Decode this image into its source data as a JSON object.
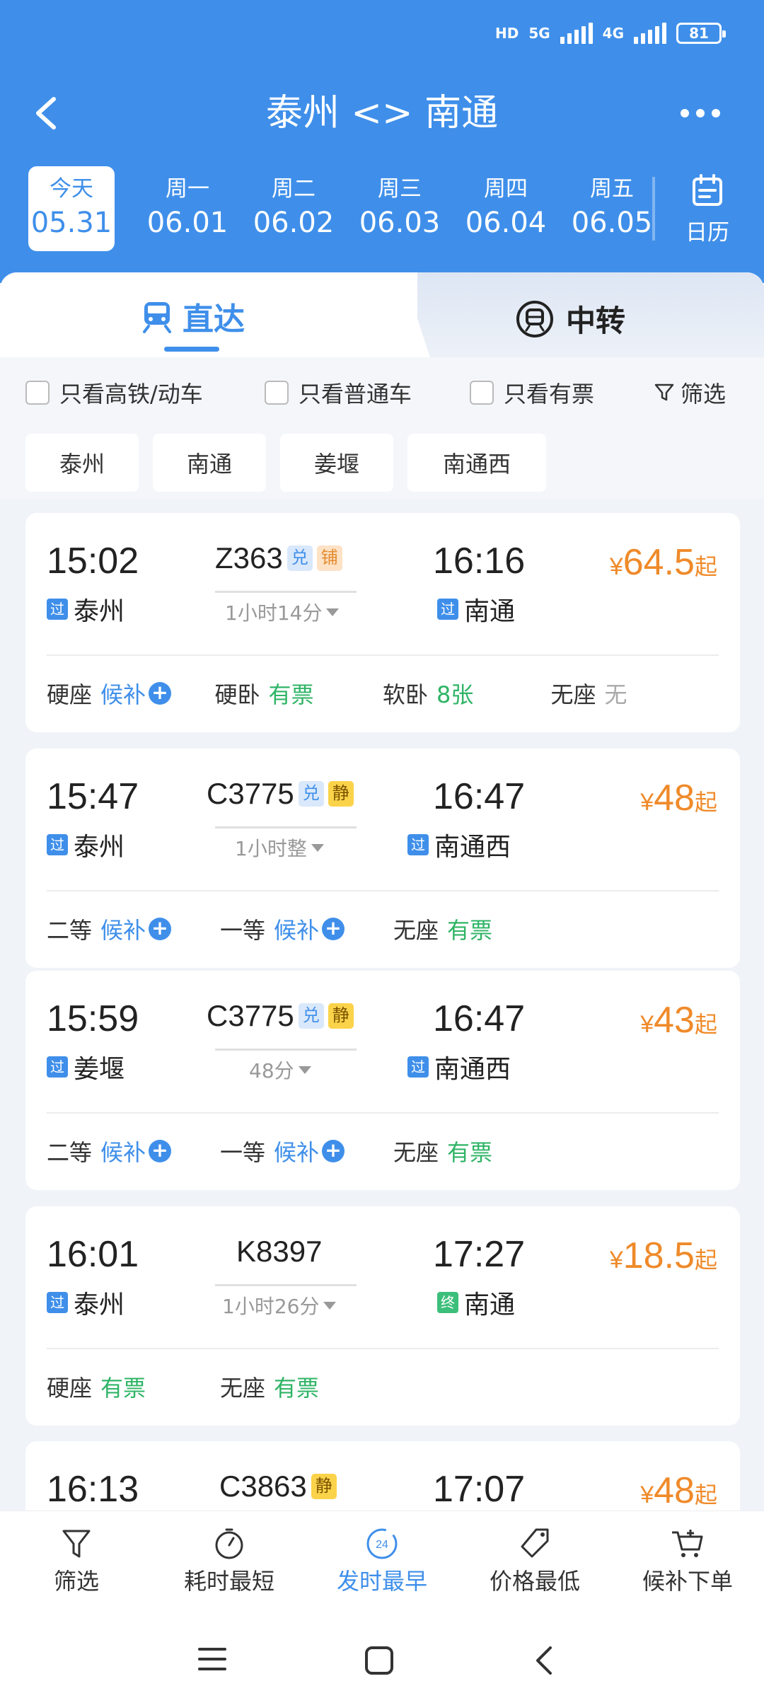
{
  "status_bar": {
    "hd": "HD",
    "net1": "5G",
    "net2": "4G",
    "battery": "81"
  },
  "header": {
    "title": "泰州 <> 南通"
  },
  "dates": [
    {
      "weekday": "今天",
      "date": "05.31",
      "active": true
    },
    {
      "weekday": "周一",
      "date": "06.01"
    },
    {
      "weekday": "周二",
      "date": "06.02"
    },
    {
      "weekday": "周三",
      "date": "06.03"
    },
    {
      "weekday": "周四",
      "date": "06.04"
    },
    {
      "weekday": "周五",
      "date": "06.05"
    }
  ],
  "calendar_label": "日历",
  "tabs": {
    "direct": "直达",
    "transfer": "中转"
  },
  "filters": {
    "hsr": "只看高铁/动车",
    "normal": "只看普通车",
    "available": "只看有票",
    "filter": "筛选"
  },
  "stations": [
    "泰州",
    "南通",
    "姜堰",
    "南通西"
  ],
  "trains": [
    {
      "dep_time": "15:02",
      "from": "泰州",
      "from_tag": "过",
      "train_no": "Z363",
      "badges": [
        "兑",
        "铺"
      ],
      "duration": "1小时14分",
      "arr_time": "16:16",
      "to": "南通",
      "to_tag": "过",
      "price_cur": "¥",
      "price": "64.5",
      "price_suffix": "起",
      "seats": [
        {
          "name": "硬座",
          "status": "候补"
        },
        {
          "name": "硬卧",
          "status": "有票"
        },
        {
          "name": "软卧",
          "status": "8张"
        },
        {
          "name": "无座",
          "status": "无"
        }
      ]
    },
    {
      "dep_time": "15:47",
      "from": "泰州",
      "from_tag": "过",
      "train_no": "C3775",
      "badges": [
        "兑",
        "静"
      ],
      "duration": "1小时整",
      "arr_time": "16:47",
      "to": "南通西",
      "to_tag": "过",
      "price_cur": "¥",
      "price": "48",
      "price_suffix": "起",
      "seats": [
        {
          "name": "二等",
          "status": "候补"
        },
        {
          "name": "一等",
          "status": "候补"
        },
        {
          "name": "无座",
          "status": "有票"
        }
      ]
    },
    {
      "dep_time": "15:59",
      "from": "姜堰",
      "from_tag": "过",
      "train_no": "C3775",
      "badges": [
        "兑",
        "静"
      ],
      "duration": "48分",
      "arr_time": "16:47",
      "to": "南通西",
      "to_tag": "过",
      "price_cur": "¥",
      "price": "43",
      "price_suffix": "起",
      "seats": [
        {
          "name": "二等",
          "status": "候补"
        },
        {
          "name": "一等",
          "status": "候补"
        },
        {
          "name": "无座",
          "status": "有票"
        }
      ]
    },
    {
      "dep_time": "16:01",
      "from": "泰州",
      "from_tag": "过",
      "train_no": "K8397",
      "badges": [],
      "duration": "1小时26分",
      "arr_time": "17:27",
      "to": "南通",
      "to_tag": "终",
      "price_cur": "¥",
      "price": "18.5",
      "price_suffix": "起",
      "seats": [
        {
          "name": "硬座",
          "status": "有票"
        },
        {
          "name": "无座",
          "status": "有票"
        }
      ]
    },
    {
      "dep_time": "16:13",
      "train_no": "C3863",
      "badges": [
        "静"
      ],
      "arr_time": "17:07",
      "price_cur": "¥",
      "price": "48",
      "price_suffix": "起"
    }
  ],
  "bottom_bar": [
    {
      "label": "筛选",
      "icon": "filter-icon"
    },
    {
      "label": "耗时最短",
      "icon": "timer-icon"
    },
    {
      "label": "发时最早",
      "icon": "clock-24-icon",
      "active": true
    },
    {
      "label": "价格最低",
      "icon": "price-tag-icon"
    },
    {
      "label": "候补下单",
      "icon": "cart-icon"
    }
  ],
  "clock24": "24",
  "colors": {
    "primary": "#3f8fea",
    "price": "#ef8a2a",
    "available": "#2fb466"
  }
}
